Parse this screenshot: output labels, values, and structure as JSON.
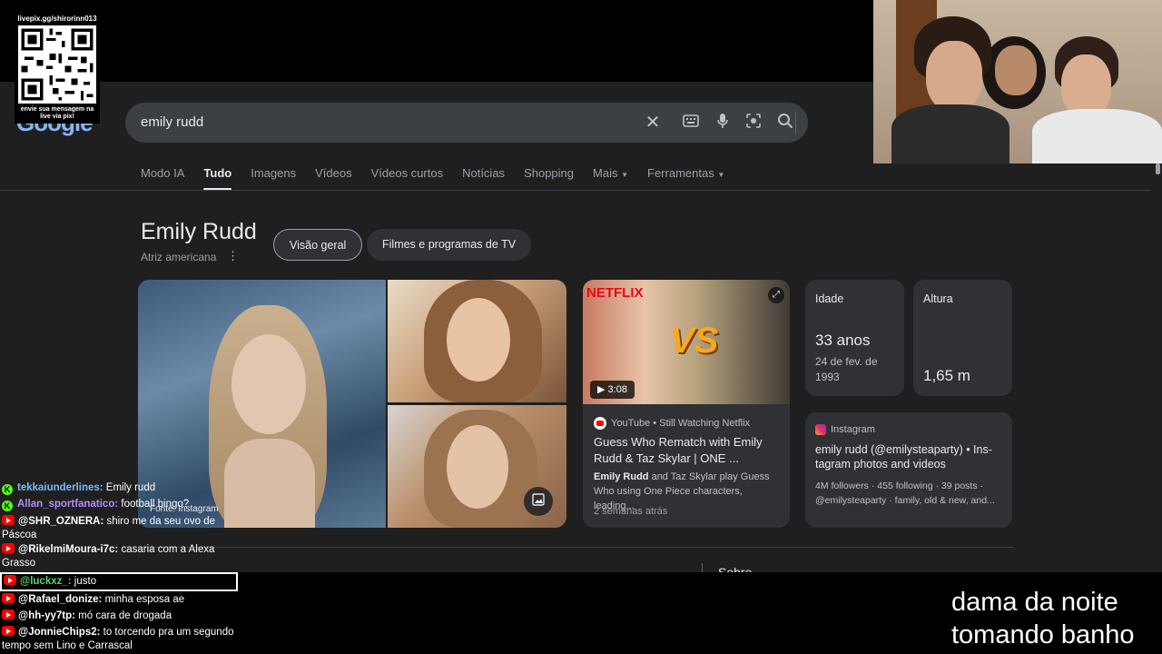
{
  "overlay": {
    "qr_url": "livepix.gg/shirorinn013",
    "qr_caption": "envie sua mensagem na live via pix!",
    "caption_lines": [
      "dama da noite",
      "tomando banho"
    ]
  },
  "google": {
    "logo_text": "Google",
    "search_query": "emily rudd",
    "tabs": [
      "Modo IA",
      "Tudo",
      "Imagens",
      "Vídeos",
      "Vídeos curtos",
      "Notícias",
      "Shopping",
      "Mais",
      "Ferramentas"
    ],
    "active_tab": "Tudo"
  },
  "knowledge_panel": {
    "title": "Emily Rudd",
    "subtitle": "Atriz americana",
    "chips": [
      "Visão geral",
      "Filmes e programas de TV"
    ],
    "photo_source": "Fonte: Instagram",
    "video": {
      "brand": "NETFLIX",
      "vs_text": "VS",
      "duration": "3:08",
      "source": "YouTube • Still Watching Netflix",
      "title": "Guess Who Rematch with Emily Rudd & Taz Skylar | ONE ...",
      "desc_bold": "Emily Rudd",
      "desc_rest": " and Taz Skylar play Guess Who using One Piece characters, leading...",
      "date": "2 semanas atrás"
    },
    "facts": {
      "age_label": "Idade",
      "age_value": "33 anos",
      "age_sub": "24 de fev. de 1993",
      "height_label": "Altura",
      "height_value": "1,65 m"
    },
    "instagram": {
      "source": "Instagram",
      "title": "emily rudd (@emilysteaparty) • Ins-tagram photos and videos",
      "meta1": "4M followers · 455 following · 39 posts ·",
      "meta2": "@emilysteaparty · family, old & new, and..."
    },
    "next_section": "Sobre"
  },
  "chat": [
    {
      "user": "tekkaiunderlines:",
      "text": " Emily rudd",
      "color": "#7ab8ff",
      "platform": "kick"
    },
    {
      "user": "Allan_sportfanatico:",
      "text": " football bingo?",
      "color": "#b58cff",
      "platform": "kick"
    },
    {
      "user": "@SHR_OZNERA:",
      "text": " shiro me da seu ovo de Páscoa",
      "color": "#ffffff",
      "platform": "youtube"
    },
    {
      "user": "@RikelmiMoura-i7c:",
      "text": " casaria com a Alexa Grasso",
      "color": "#ffffff",
      "platform": "youtube"
    },
    {
      "user": "@luckxz_:",
      "text": " justo",
      "color": "#5fd35f",
      "platform": "youtube"
    },
    {
      "user": "@Rafael_donize:",
      "text": " minha esposa ae",
      "color": "#ffffff",
      "platform": "youtube"
    },
    {
      "user": "@hh-yy7tp:",
      "text": " mó cara de drogada",
      "color": "#ffffff",
      "platform": "youtube"
    },
    {
      "user": "@JonnieChips2:",
      "text": " to torcendo pra um segundo tempo sem Lino e Carrascal",
      "color": "#ffffff",
      "platform": "youtube"
    }
  ]
}
